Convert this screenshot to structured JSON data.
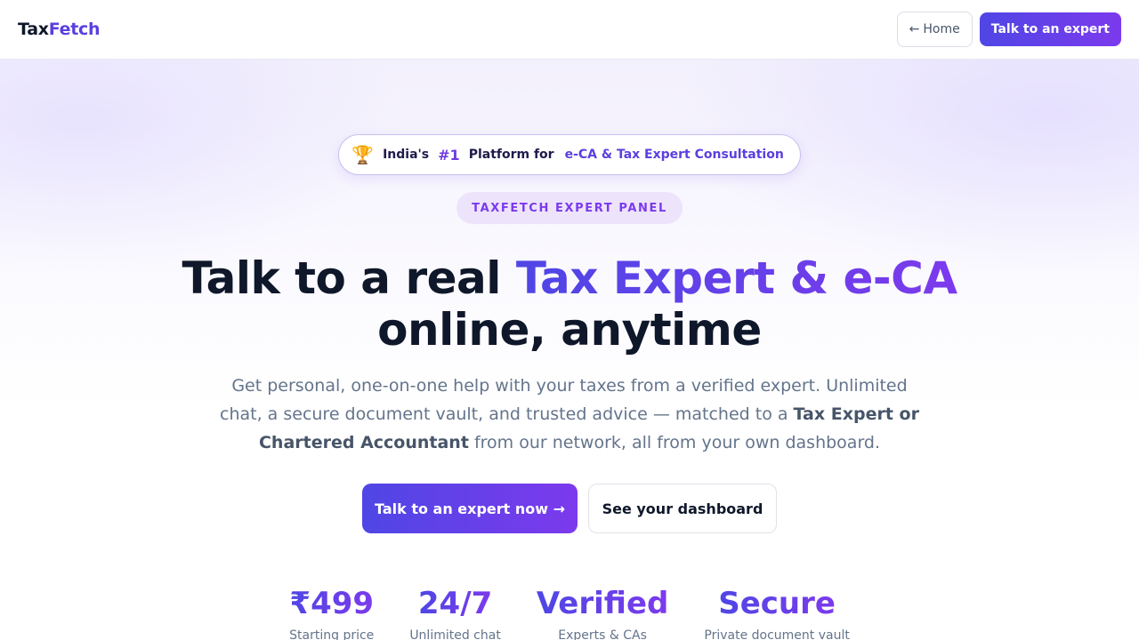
{
  "brand": {
    "part1": "Tax",
    "part2": "Fetch"
  },
  "nav": {
    "home_arrow": "←",
    "home_label": "Home",
    "cta_label": "Talk to an expert"
  },
  "badge": {
    "icon": "trophy-icon",
    "icon_glyph": "🏆",
    "prefix": "India's",
    "number": "#1",
    "middle": "Platform for",
    "highlight": "e-CA & Tax Expert Consultation"
  },
  "eyebrow": "TAXFETCH EXPERT PANEL",
  "headline": {
    "plain": "Talk to a real ",
    "highlight": "Tax Expert & e-CA",
    "line2": "online, anytime"
  },
  "subtitle": {
    "part1": "Get personal, one-on-one help with your taxes from a verified expert. Unlimited chat, a secure document vault, and trusted advice — matched to a ",
    "bold": "Tax Expert or Chartered Accountant",
    "part2": " from our network, all from your own dashboard."
  },
  "ctas": {
    "primary": "Talk to an expert now →",
    "secondary": "See your dashboard"
  },
  "stats": [
    {
      "value": "₹499",
      "label": "Starting price"
    },
    {
      "value": "24/7",
      "label": "Unlimited chat"
    },
    {
      "value": "Verified",
      "label": "Experts & CAs"
    },
    {
      "value": "Secure",
      "label": "Private document vault"
    }
  ],
  "colors": {
    "accent_start": "#4f46e5",
    "accent_end": "#7c3aed",
    "heading": "#0f172a",
    "muted": "#64748b"
  }
}
